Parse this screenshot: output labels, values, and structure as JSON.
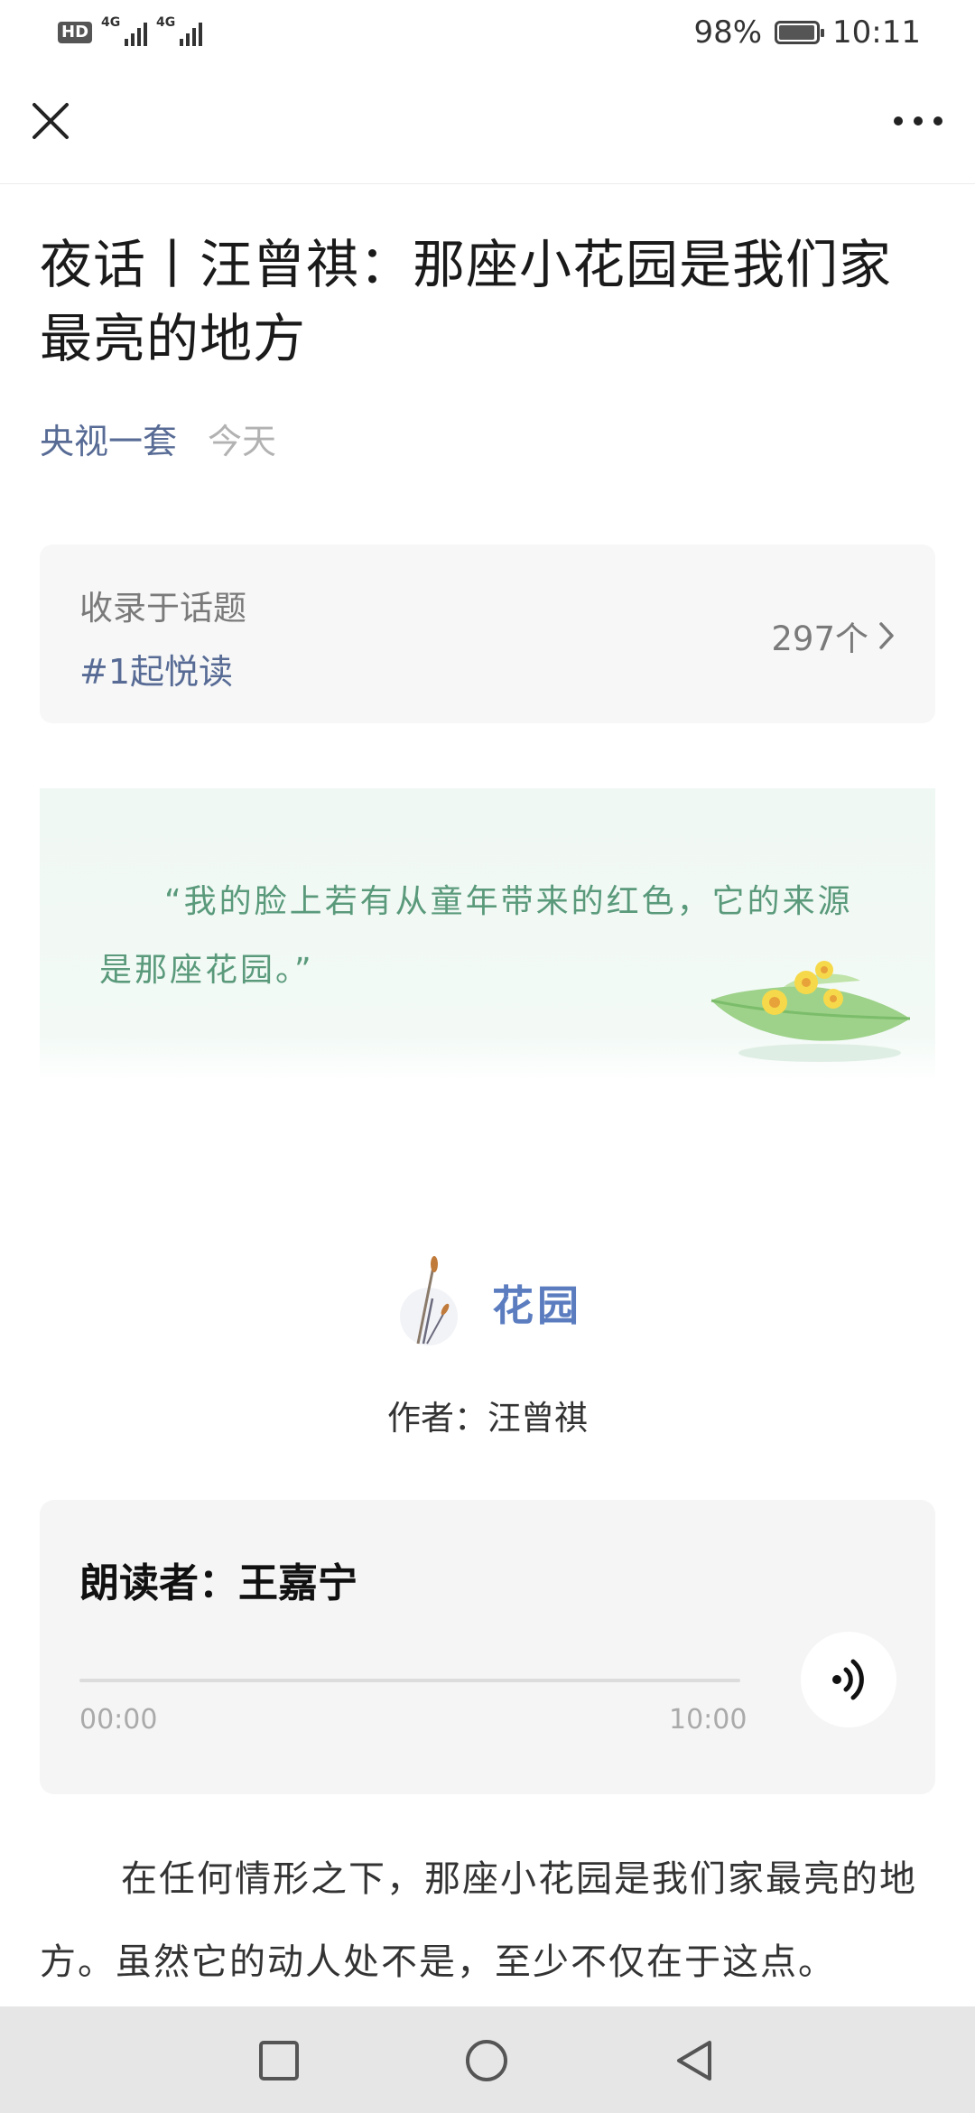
{
  "status_bar": {
    "hd_label": "HD",
    "network_1": "4G",
    "network_2": "4G",
    "battery_percent": "98%",
    "battery_level": 0.98,
    "time": "10:11"
  },
  "nav": {
    "close_icon": "close-icon",
    "more_icon": "more-dots-icon"
  },
  "article": {
    "title": "夜话丨汪曾祺：那座小花园是我们家最亮的地方",
    "account": "央视一套",
    "date": "今天"
  },
  "topic": {
    "label": "收录于话题",
    "name": "#1起悦读",
    "count": "297个"
  },
  "quote": {
    "text": "“我的脸上若有从童年带来的红色，它的来源是那座花园。”"
  },
  "section": {
    "title": "花园",
    "author": "作者：汪曾祺"
  },
  "audio": {
    "reader": "朗读者：王嘉宁",
    "current_time": "00:00",
    "duration": "10:00",
    "progress": 0,
    "play_icon": "audio-wave-icon"
  },
  "body": {
    "paragraph_1": "在任何情形之下，那座小花园是我们家最亮的地方。虽然它的动人处不是，至少不仅在于这点。"
  },
  "system_nav": {
    "recent_icon": "square-recent-icon",
    "home_icon": "circle-home-icon",
    "back_icon": "triangle-back-icon"
  }
}
